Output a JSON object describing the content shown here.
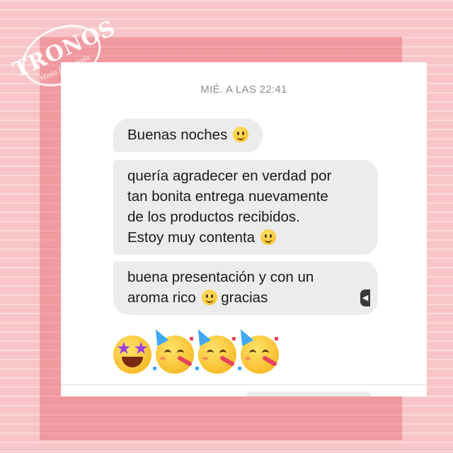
{
  "watermark": {
    "brand": "TRONOS",
    "tagline": "Moda Importada"
  },
  "chat": {
    "timestamp": "MIÉ. A LAS 22:41",
    "messages": [
      {
        "lines": [
          "Buenas noches"
        ],
        "trailing_emoji": "slightly-smiling-face"
      },
      {
        "lines": [
          "quería agradecer en verdad por",
          "tan bonita entrega nuevamente",
          "de los productos recibidos.",
          "Estoy muy contenta"
        ],
        "trailing_emoji": "slightly-smiling-face"
      },
      {
        "lines": [
          "buena presentación y con un",
          "aroma rico",
          "gracias"
        ],
        "inline_emoji": "slightly-smiling-face"
      }
    ],
    "reaction_emojis": [
      "star-struck",
      "partying-face",
      "partying-face",
      "partying-face"
    ]
  },
  "colors": {
    "background": "#f7c5c8",
    "frame": "#f0999f",
    "bubble": "#ececec",
    "timestamp_text": "#8c8c8c"
  }
}
